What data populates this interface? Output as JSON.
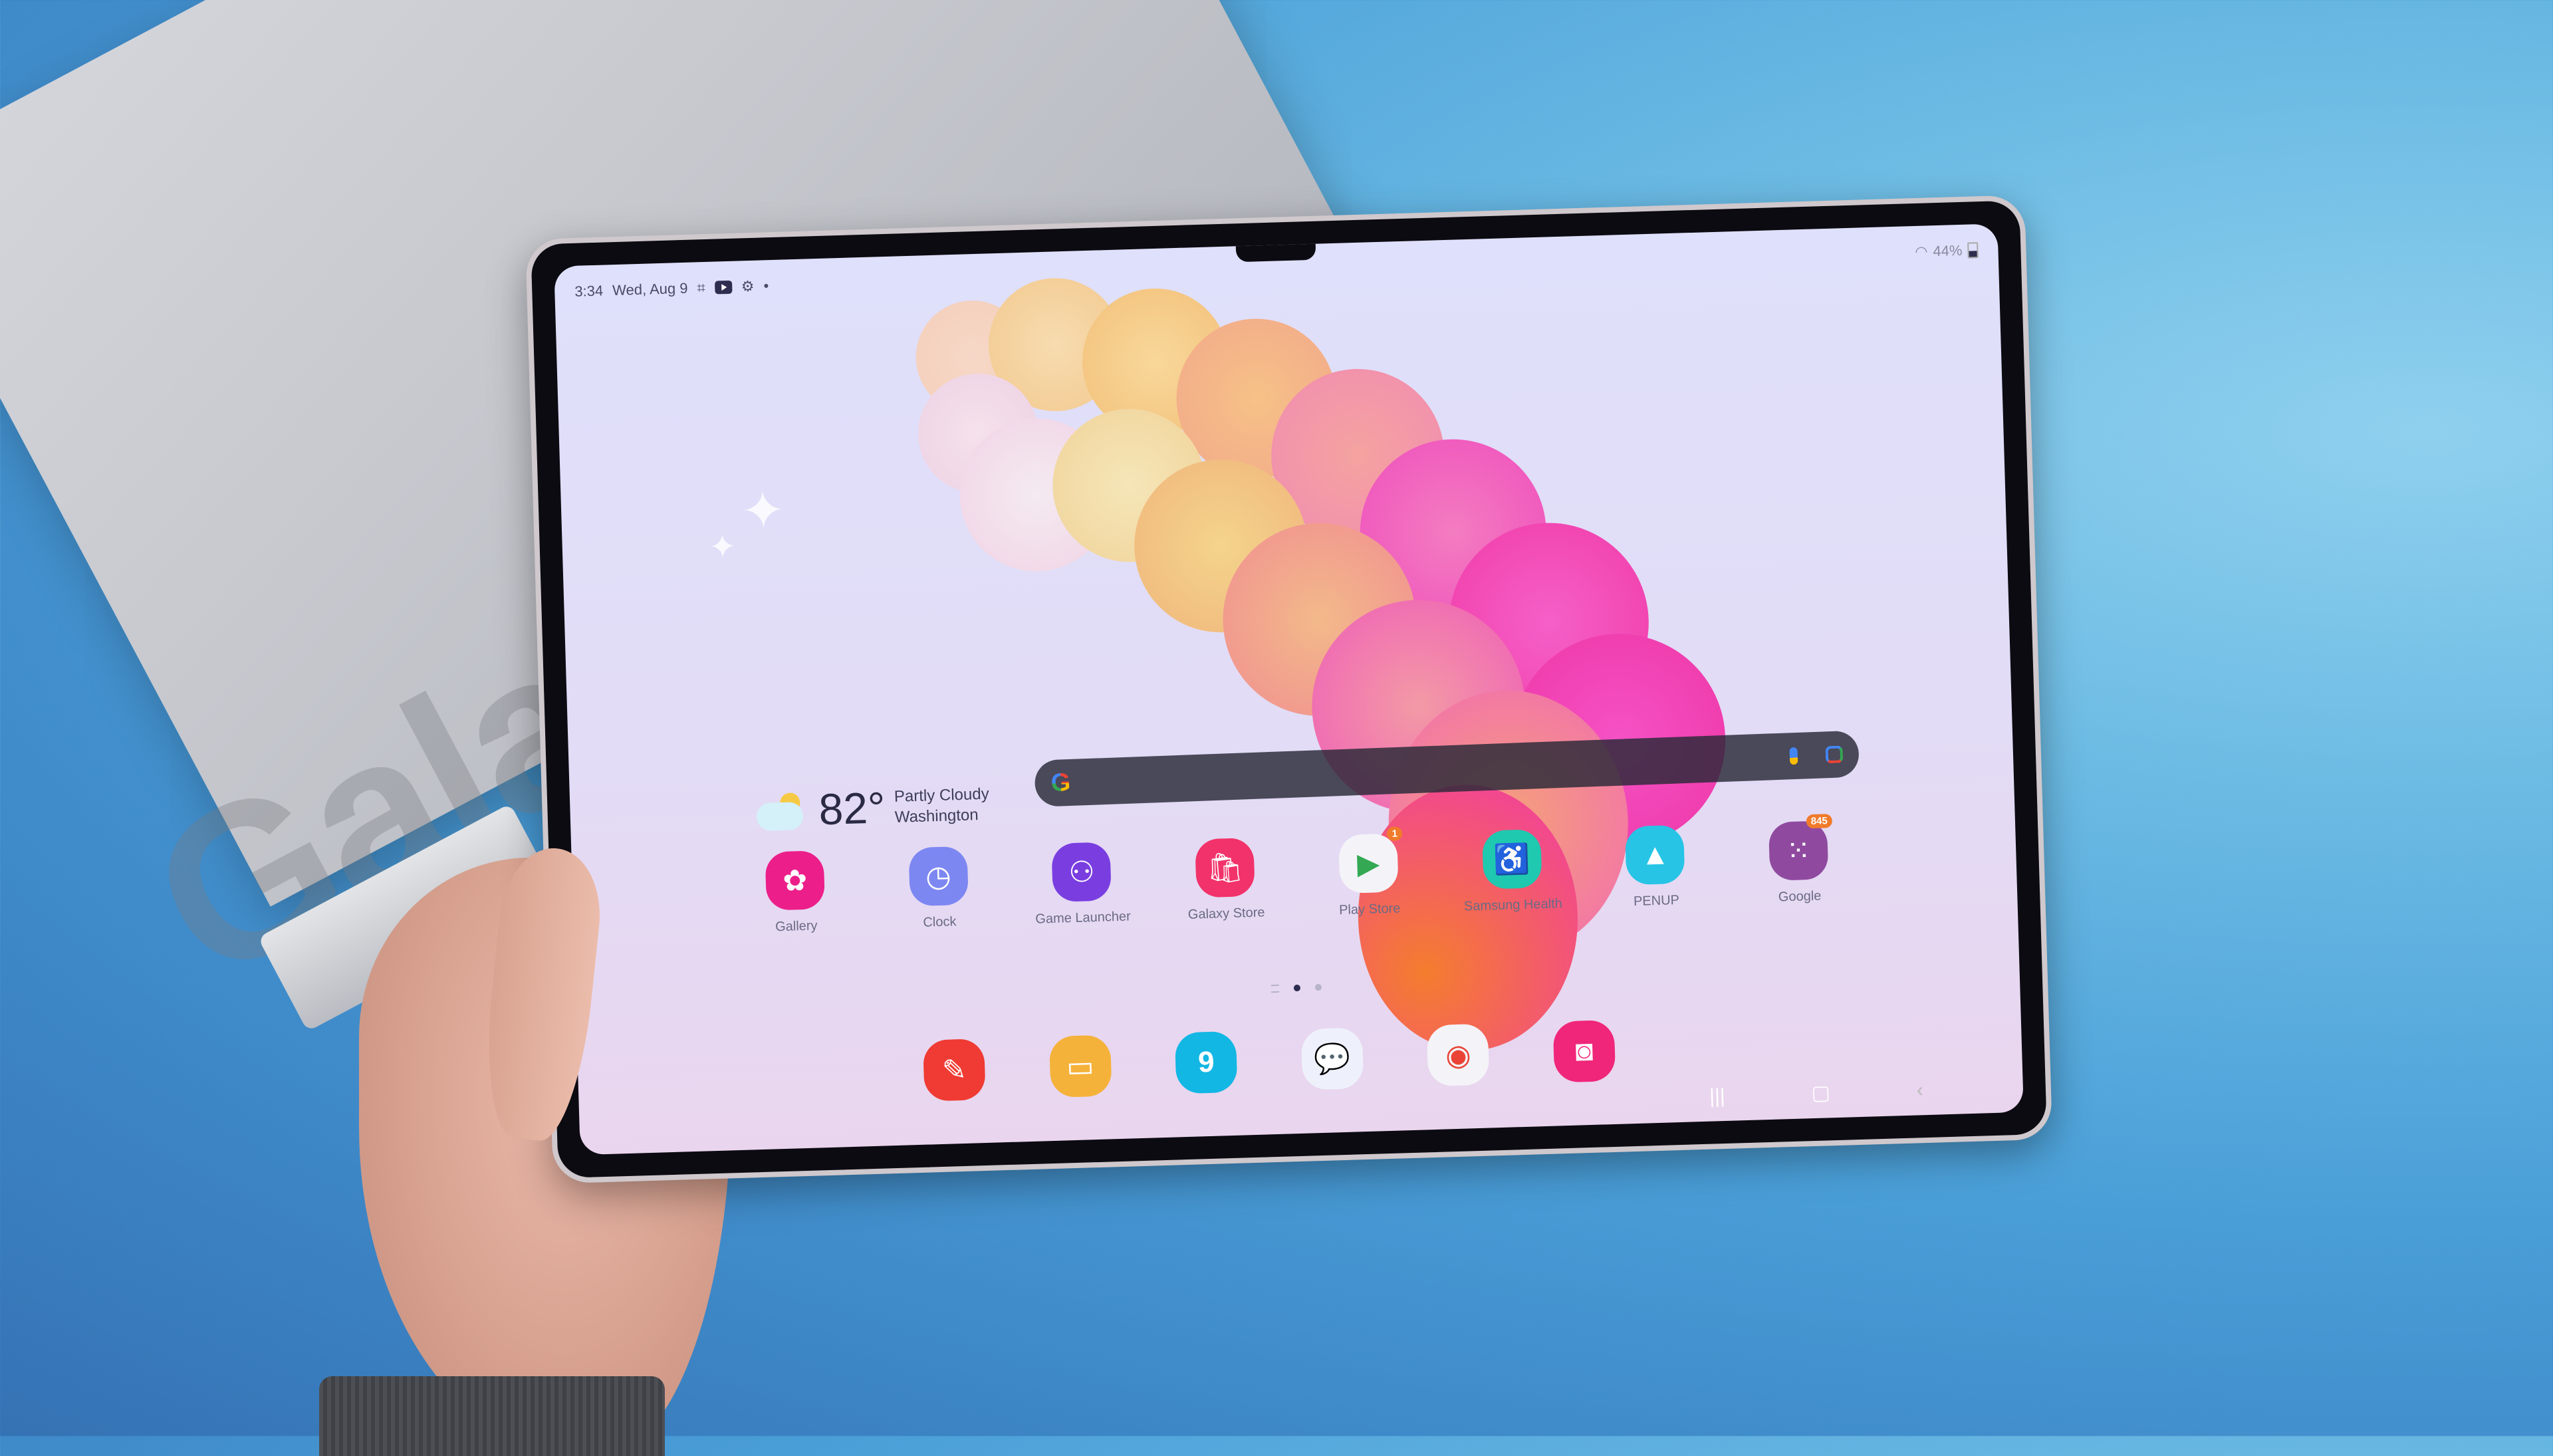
{
  "status_bar": {
    "time": "3:34",
    "date": "Wed, Aug 9",
    "left_icons": [
      "screen-capture-icon",
      "youtube-icon",
      "settings-gear-icon",
      "notification-dot-icon"
    ],
    "battery_percent": "44%",
    "right_icons": [
      "wifi-icon",
      "battery-icon"
    ]
  },
  "weather_widget": {
    "temperature": "82°",
    "condition": "Partly Cloudy",
    "location": "Washington",
    "icon": "partly-cloudy-icon"
  },
  "search_bar": {
    "logo": "G",
    "icons": [
      "mic-icon",
      "google-lens-icon"
    ]
  },
  "apps": [
    {
      "label": "Gallery",
      "icon": "gallery-icon",
      "glyph": "✿",
      "color": "#ec1f8a"
    },
    {
      "label": "Clock",
      "icon": "clock-icon",
      "glyph": "◷",
      "color": "#7d87f2"
    },
    {
      "label": "Game Launcher",
      "icon": "game-launcher-icon",
      "glyph": "⚇",
      "color": "#7a3ee0"
    },
    {
      "label": "Galaxy Store",
      "icon": "galaxy-store-icon",
      "glyph": "🛍",
      "color": "#f2326a"
    },
    {
      "label": "Play Store",
      "icon": "play-store-icon",
      "glyph": "▶",
      "color": "#f4f4f8",
      "badge": "1"
    },
    {
      "label": "Samsung Health",
      "icon": "samsung-health-icon",
      "glyph": "♿",
      "color": "#1ec9b0"
    },
    {
      "label": "PENUP",
      "icon": "penup-icon",
      "glyph": "▲",
      "color": "#27c4e6"
    },
    {
      "label": "Google",
      "icon": "google-folder-icon",
      "glyph": "⁙",
      "color": "#8f4aa0",
      "badge": "845"
    }
  ],
  "page_indicator": {
    "pages": 3,
    "current": 2
  },
  "dock": [
    {
      "icon": "samsung-notes-icon",
      "glyph": "✎",
      "color": "#ef3b33"
    },
    {
      "icon": "my-files-icon",
      "glyph": "▭",
      "color": "#f5b23a"
    },
    {
      "icon": "calendar-icon",
      "glyph": "9",
      "color": "#12b7e4"
    },
    {
      "icon": "messages-icon",
      "glyph": "💬",
      "color": "#eef1fb"
    },
    {
      "icon": "chrome-icon",
      "glyph": "◉",
      "color": "#f4f4f8"
    },
    {
      "icon": "camera-icon",
      "glyph": "◙",
      "color": "#f0267a"
    }
  ],
  "nav_bar": {
    "recents": "|||",
    "home": "▢",
    "back": "‹"
  },
  "background": {
    "box_brand_text": "Gala"
  }
}
